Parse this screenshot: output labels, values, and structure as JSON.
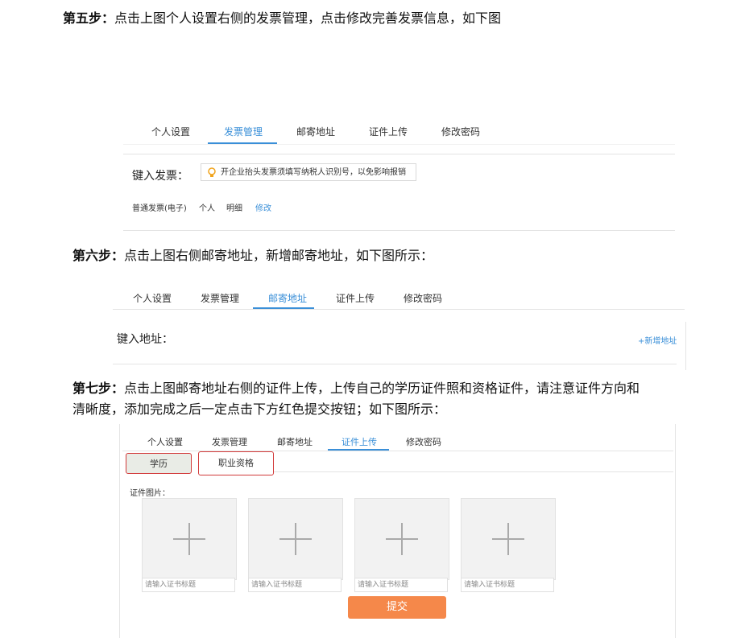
{
  "step5": {
    "prefix": "第五步：",
    "text": "点击上图个人设置右侧的发票管理，点击修改完善发票信息，如下图"
  },
  "panel1": {
    "tabs": [
      "个人设置",
      "发票管理",
      "邮寄地址",
      "证件上传",
      "修改密码"
    ],
    "active_tab": 1,
    "title": "键入发票：",
    "tip": "开企业抬头发票须填写纳税人识别号，以免影响报销",
    "row": {
      "type": "普通发票(电子)",
      "owner": "个人",
      "detail": "明细",
      "edit": "修改"
    }
  },
  "step6": {
    "prefix": "第六步：",
    "text": "点击上图右侧邮寄地址，新增邮寄地址，如下图所示："
  },
  "panel2": {
    "tabs": [
      "个人设置",
      "发票管理",
      "邮寄地址",
      "证件上传",
      "修改密码"
    ],
    "active_tab": 2,
    "title": "键入地址：",
    "add_link": "+新增地址"
  },
  "step7": {
    "prefix": "第七步：",
    "line1": "点击上图邮寄地址右侧的证件上传，上传自己的学历证件照和资格证件，请注意证件方向和",
    "line2": "清晰度，添加完成之后一定点击下方红色提交按钮；如下图所示："
  },
  "panel3": {
    "tabs": [
      "个人设置",
      "发票管理",
      "邮寄地址",
      "证件上传",
      "修改密码"
    ],
    "active_tab": 3,
    "segments": [
      "学历",
      "职业资格"
    ],
    "image_label": "证件图片：",
    "upload_placeholder": "请输入证书标题",
    "upload_slots": 4,
    "submit_label": "提交"
  },
  "colors": {
    "accent": "#3a8fd8",
    "highlight": "#d23a3a",
    "submit": "#f5884a"
  },
  "icons": {
    "tip": "lightbulb-icon",
    "upload": "plus-icon"
  }
}
